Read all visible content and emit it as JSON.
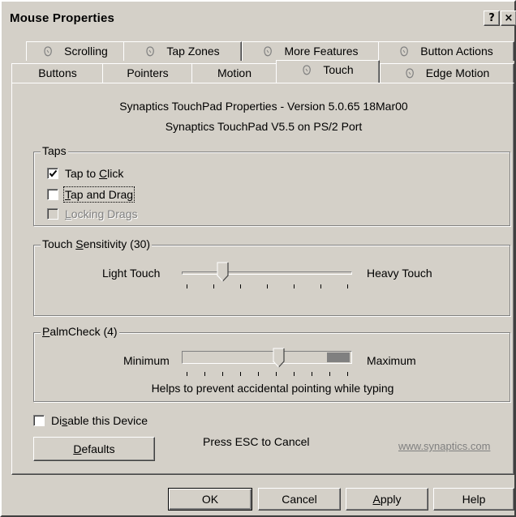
{
  "window": {
    "title": "Mouse Properties",
    "help_glyph": "?",
    "close_glyph": "×"
  },
  "tabs": {
    "row1": [
      "Scrolling",
      "Tap Zones",
      "More Features",
      "Button Actions"
    ],
    "row2": [
      "Buttons",
      "Pointers",
      "Motion",
      "Touch",
      "Edge Motion"
    ],
    "active": "Touch"
  },
  "info": {
    "version_line": "Synaptics TouchPad Properties - Version 5.0.65 18Mar00",
    "port_line": "Synaptics TouchPad V5.5 on PS/2 Port"
  },
  "taps": {
    "title": "Taps",
    "tap_to_click": {
      "pre": "Tap to ",
      "ul": "C",
      "post": "lick",
      "checked": true
    },
    "tap_and_drag": {
      "pre": "",
      "ul": "T",
      "post": "ap and Drag",
      "checked": false
    },
    "locking_drags": {
      "pre": "",
      "ul": "L",
      "post": "ocking Drags",
      "checked": false,
      "enabled": false
    }
  },
  "sensitivity": {
    "title_pre": "Touch ",
    "title_ul": "S",
    "title_post": "ensitivity (30)",
    "min_label": "Light Touch",
    "max_label": "Heavy Touch",
    "value_fraction": 0.22,
    "tick_count": 7
  },
  "palmcheck": {
    "title_ul": "P",
    "title_post": "almCheck (4)",
    "min_label": "Minimum",
    "max_label": "Maximum",
    "value_fraction": 0.57,
    "tick_count": 10,
    "hint": "Helps to prevent accidental pointing while typing"
  },
  "disable": {
    "pre": "Di",
    "ul": "s",
    "post": "able this Device",
    "checked": false
  },
  "defaults_button": {
    "ul": "D",
    "post": "efaults"
  },
  "esc_text": "Press ESC to Cancel",
  "link": "www.synaptics.com",
  "bottom_buttons": {
    "ok": "OK",
    "cancel": "Cancel",
    "apply_ul": "A",
    "apply_post": "pply",
    "help": "Help"
  },
  "colors": {
    "face": "#d4d0c8",
    "palm_zone": "#808080"
  }
}
